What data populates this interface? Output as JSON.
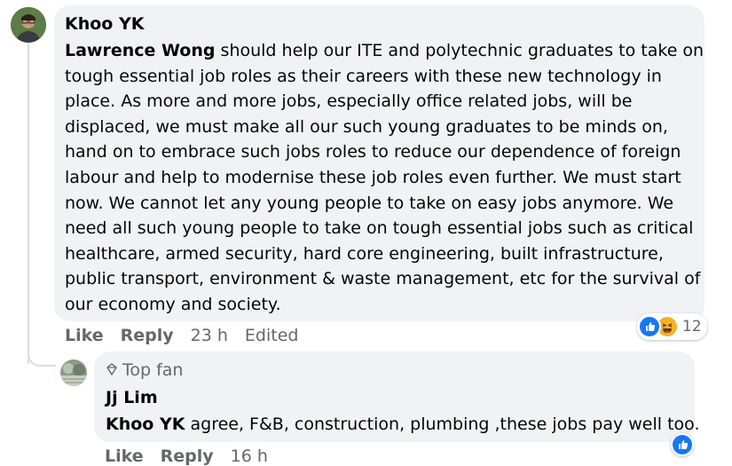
{
  "comment": {
    "author": "Khoo YK",
    "mention": "Lawrence Wong",
    "lines": [
      " should help our ITE and polytechnic graduates to take on",
      "tough essential job roles as their careers with these new technology in",
      "place. As more and more jobs, especially office related jobs, will be",
      "displaced, we must make all our such young graduates to be minds on,",
      "hand on to embrace such jobs roles to reduce our dependence of foreign",
      "labour and help to modernise these job roles even further. We must start",
      "now. We cannot let any young people to take on easy jobs anymore. We",
      "need all such young people to take on tough essential jobs such as critical",
      "healthcare, armed security, hard core engineering, built infrastructure,",
      "public transport, environment & waste management, etc for the survival of",
      "our economy and society."
    ],
    "reaction_count": "12",
    "like_label": "Like",
    "reply_label": "Reply",
    "time": "23 h",
    "edited": "Edited"
  },
  "reply": {
    "badge": "Top fan",
    "author": "Jj Lim",
    "mention": "Khoo YK",
    "text": " agree, F&B, construction, plumbing ,these jobs pay well too.",
    "like_label": "Like",
    "reply_label": "Reply",
    "time": "16 h"
  },
  "colors": {
    "like_blue": "#1877f2",
    "haha_yellow": "#f7b125",
    "bubble_bg": "#f0f2f5",
    "meta_gray": "#65676b"
  },
  "icons": [
    "like-reaction-icon",
    "haha-reaction-icon",
    "top-fan-badge-icon"
  ]
}
